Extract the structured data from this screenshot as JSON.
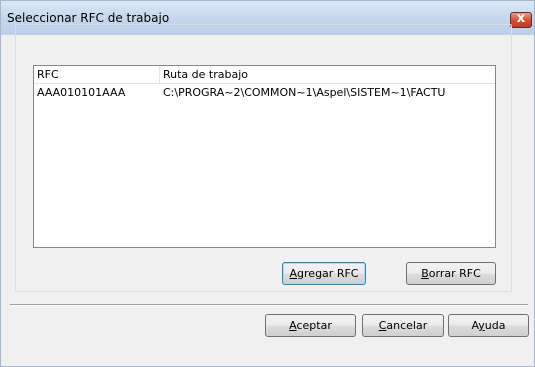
{
  "window": {
    "title": "Seleccionar RFC de trabajo",
    "close_glyph": "x"
  },
  "list": {
    "columns": [
      "RFC",
      "Ruta de trabajo"
    ],
    "rows": [
      {
        "rfc": "AAA010101AAA",
        "ruta": "C:\\PROGRA~2\\COMMON~1\\Aspel\\SISTEM~1\\FACTU"
      }
    ]
  },
  "buttons": {
    "agregar": {
      "first": "A",
      "rest": "gregar RFC"
    },
    "borrar": {
      "first": "B",
      "rest": "orrar RFC"
    },
    "aceptar": {
      "first": "A",
      "rest": "ceptar"
    },
    "cancelar": {
      "first": "C",
      "rest": "ancelar"
    },
    "ayuda": {
      "pre": "A",
      "mid": "y",
      "post": "uda"
    }
  },
  "colors": {
    "titlebar": "#c4d6ec",
    "close_button": "#c23a22",
    "dialog_bg": "#f0f0f0"
  }
}
